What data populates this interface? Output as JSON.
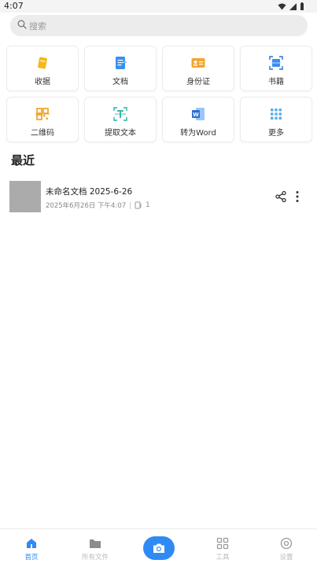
{
  "status_bar": {
    "time": "4:07"
  },
  "search": {
    "placeholder": "搜索"
  },
  "tools": [
    {
      "label": "收据",
      "icon": "receipt-icon"
    },
    {
      "label": "文档",
      "icon": "document-icon"
    },
    {
      "label": "身份证",
      "icon": "id-card-icon"
    },
    {
      "label": "书籍",
      "icon": "book-scan-icon"
    },
    {
      "label": "二维码",
      "icon": "qr-code-icon"
    },
    {
      "label": "提取文本",
      "icon": "extract-text-icon"
    },
    {
      "label": "转为Word",
      "icon": "word-icon"
    },
    {
      "label": "更多",
      "icon": "grid-more-icon"
    }
  ],
  "recent": {
    "title": "最近",
    "items": [
      {
        "name": "未命名文档 2025-6-26",
        "date": "2025年6月26日 下午4:07",
        "pages": "1"
      }
    ]
  },
  "nav": [
    {
      "label": "首页",
      "icon": "home-icon",
      "active": true
    },
    {
      "label": "所有文件",
      "icon": "folder-icon",
      "active": false
    },
    {
      "label": "",
      "icon": "camera-icon",
      "active": false
    },
    {
      "label": "工具",
      "icon": "tools-grid-icon",
      "active": false
    },
    {
      "label": "设置",
      "icon": "settings-icon",
      "active": false
    }
  ],
  "colors": {
    "accent": "#2f8af5",
    "receipt": "#f5b81c",
    "doc": "#3a8ff0",
    "id": "#f3a72f",
    "qr": "#f3a72f",
    "more": "#5aaee8"
  }
}
